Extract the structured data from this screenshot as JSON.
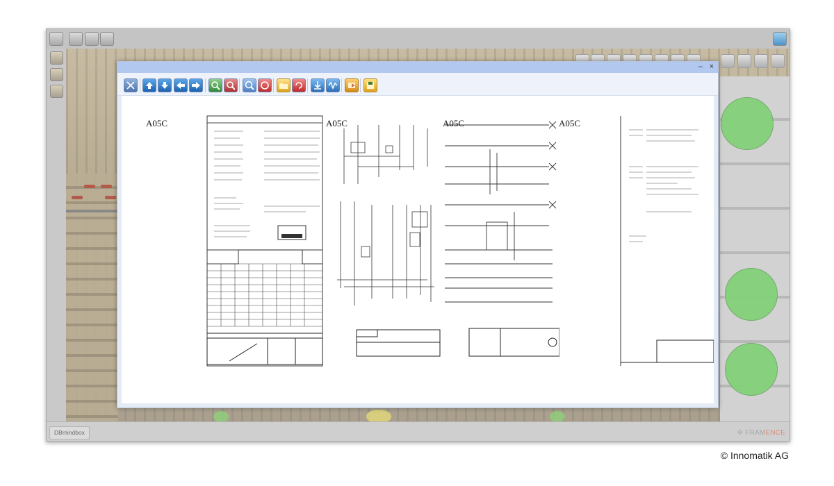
{
  "window": {
    "title": ""
  },
  "scene": {
    "colors": {
      "status_green": "#84d17a",
      "accent_red": "#e08c7a"
    }
  },
  "bottom_bar": {
    "tab_label": "DBmindbox",
    "brand_part1": "FRAM",
    "brand_part2": "ENCE"
  },
  "viewer": {
    "controls": {
      "minimize": "–",
      "close": "×"
    },
    "toolbar_icons": [
      "tools-icon",
      "arrow-up-icon",
      "arrow-down-icon",
      "arrow-left-icon",
      "arrow-right-icon",
      "zoom-in-icon",
      "zoom-out-icon",
      "zoom-fit-icon",
      "rotate-icon",
      "folder-open-icon",
      "refresh-icon",
      "download-icon",
      "waveform-icon",
      "export-icon",
      "save-icon"
    ],
    "pages": [
      {
        "label": "A05C"
      },
      {
        "label": "A05C"
      },
      {
        "label": "A05C"
      },
      {
        "label": "A05C"
      }
    ]
  },
  "copyright": "© Innomatik AG"
}
